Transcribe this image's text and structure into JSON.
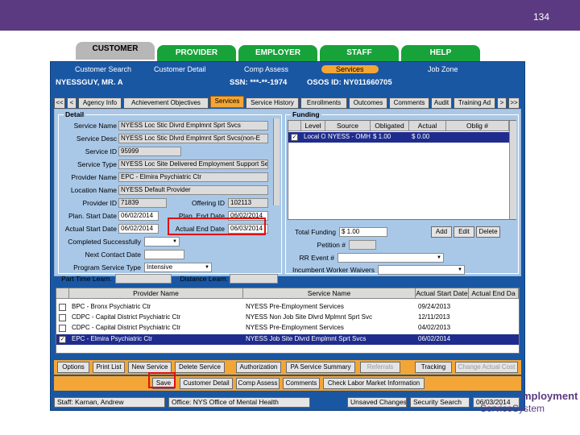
{
  "slide_number": "134",
  "main_tabs": [
    {
      "label": "CUSTOMER",
      "active": true
    },
    {
      "label": "PROVIDER"
    },
    {
      "label": "EMPLOYER"
    },
    {
      "label": "STAFF"
    },
    {
      "label": "HELP"
    }
  ],
  "subnav": [
    "Customer Search",
    "Customer Detail",
    "Comp Assess",
    "Services",
    "Job Zone"
  ],
  "info": {
    "name": "NYESSGUY, MR. A",
    "ssn": "SSN: ***-**-1974",
    "osos": "OSOS ID: NY011660705"
  },
  "section_tabs": [
    "<<",
    "<",
    "Agency Info",
    "Achievement Objectives",
    "Services",
    "Service History",
    "Enrollments",
    "Outcomes",
    "Comments",
    "Audit",
    "Training Ad",
    ">",
    ">>"
  ],
  "detail": {
    "legend": "Detail",
    "service_name_label": "Service Name",
    "service_name": "NYESS Loc Stic Divrd Emplmnt Sprt Svcs",
    "service_desc_label": "Service Desc",
    "service_desc": "NYESS Loc Stic Dlvrd Emplmnt Sprt Svcs(non-E",
    "service_id_label": "Service ID",
    "service_id": "95999",
    "service_type_label": "Service Type",
    "service_type": "NYESS Loc Site Delivered Employment Support Ser",
    "provider_name_label": "Provider Name",
    "provider_name": "EPC - Elmira Psychiatric Ctr",
    "location_name_label": "Location Name",
    "location_name": "NYESS Default Provider",
    "provider_id_label": "Provider ID",
    "provider_id": "71839",
    "offering_id_label": "Offering ID",
    "offering_id": "102113",
    "plan_start_label": "Plan. Start Date",
    "plan_start": "06/02/2014",
    "plan_end_label": "Plan. End Date",
    "plan_end": "06/02/2014",
    "actual_start_label": "Actual Start Date",
    "actual_start": "06/02/2014",
    "actual_end_label": "Actual End Date",
    "actual_end": "06/03/2014",
    "completed_label": "Completed Successfully",
    "next_contact_label": "Next Contact Date",
    "program_type_label": "Program Service Type",
    "program_type": "Intensive",
    "part_time_label": "Part Time Learn.",
    "distance_label": "Distance Learn."
  },
  "funding": {
    "legend": "Funding",
    "headers": [
      "Level",
      "Source",
      "Obligated",
      "Actual",
      "Oblig #"
    ],
    "row": [
      "Local O",
      "NYESS - OMH - O",
      "$ 1.00",
      "$ 0.00",
      ""
    ],
    "total_label": "Total Funding",
    "total_value": "$ 1.00",
    "petition_label": "Petition #",
    "rr_event_label": "RR Event #",
    "waivers_label": "Incumbent Worker Waivers",
    "add_label": "Add",
    "edit_label": "Edit",
    "delete_label": "Delete"
  },
  "services_table": {
    "headers": [
      "Provider Name",
      "Service Name",
      "Actual Start Date",
      "Actual End Da"
    ],
    "rows": [
      {
        "provider": "BPC - Bronx Psychiatric Ctr",
        "service": "NYESS Pre-Employment Services",
        "start": "09/24/2013",
        "end": "",
        "checked": false,
        "selected": false
      },
      {
        "provider": "CDPC - Capital District Psychiatric Ctr",
        "service": "NYESS Non Job Site Dlvrd Mplmnt Sprt Svc",
        "start": "12/11/2013",
        "end": "",
        "checked": false,
        "selected": false
      },
      {
        "provider": "CDPC - Capital District Psychiatric Ctr",
        "service": "NYESS Pre-Employment Services",
        "start": "04/02/2013",
        "end": "",
        "checked": false,
        "selected": false
      },
      {
        "provider": "EPC - Elmira Psychiatric Ctr",
        "service": "NYESS Job Site Dlvrd Emplmnt Sprt Svcs",
        "start": "06/02/2014",
        "end": "",
        "checked": true,
        "selected": true
      }
    ]
  },
  "buttons_row1": [
    "Options",
    "Print List",
    "New Service",
    "Delete Service",
    "Authorization",
    "PA Service Summary",
    "Referrals",
    "Tracking",
    "Change Actual Cost"
  ],
  "buttons_row2": [
    "Save",
    "Customer Detail",
    "Comp Assess",
    "Comments",
    "Check Labor Market Information"
  ],
  "status": {
    "staff": "Staff: Karnan, Andrew",
    "office": "Office: NYS Office of Mental Health",
    "unsaved": "Unsaved Changes",
    "security": "Security Search",
    "date": "06/03/2014"
  },
  "logo": {
    "line1": "mployment",
    "line2": "ServiceSystem"
  },
  "colors": {
    "header": "#5b3a82",
    "tab_green": "#17a33a",
    "app_blue": "#1a57a3",
    "highlight": "#e01010",
    "accent_orange": "#f3a636"
  }
}
